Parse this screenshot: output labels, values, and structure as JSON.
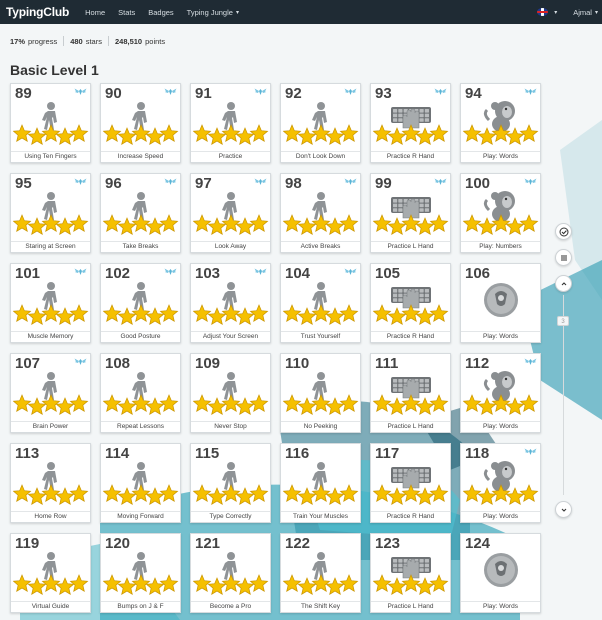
{
  "app": {
    "brand": "TypingClub"
  },
  "nav": [
    {
      "label": "Home",
      "dropdown": false
    },
    {
      "label": "Stats",
      "dropdown": false
    },
    {
      "label": "Badges",
      "dropdown": false
    },
    {
      "label": "Typing Jungle",
      "dropdown": true
    }
  ],
  "user": {
    "name": "Ajmal",
    "language_flag": "uk-flag-icon"
  },
  "stats": {
    "progress_value": "17%",
    "progress_label": "progress",
    "stars_value": "480",
    "stars_label": "stars",
    "points_value": "248,510",
    "points_label": "points"
  },
  "level": {
    "title": "Basic Level 1"
  },
  "side": {
    "page_indicator": "3"
  },
  "lessons": [
    {
      "num": "89",
      "label": "Using Ten Fingers",
      "type": "walk",
      "stars": 5,
      "badge": true
    },
    {
      "num": "90",
      "label": "Increase Speed",
      "type": "walk",
      "stars": 5,
      "badge": true
    },
    {
      "num": "91",
      "label": "Practice",
      "type": "walk",
      "stars": 5,
      "badge": true
    },
    {
      "num": "92",
      "label": "Don't Look Down",
      "type": "walk",
      "stars": 5,
      "badge": true
    },
    {
      "num": "93",
      "label": "Practice R Hand",
      "type": "hand",
      "stars": 5,
      "badge": true
    },
    {
      "num": "94",
      "label": "Play: Words",
      "type": "monkey",
      "stars": 5,
      "badge": true
    },
    {
      "num": "95",
      "label": "Staring at Screen",
      "type": "walk",
      "stars": 5,
      "badge": true
    },
    {
      "num": "96",
      "label": "Take Breaks",
      "type": "walk",
      "stars": 5,
      "badge": true
    },
    {
      "num": "97",
      "label": "Look Away",
      "type": "walk",
      "stars": 5,
      "badge": true
    },
    {
      "num": "98",
      "label": "Active Breaks",
      "type": "walk",
      "stars": 5,
      "badge": true
    },
    {
      "num": "99",
      "label": "Practice L Hand",
      "type": "hand",
      "stars": 5,
      "badge": true
    },
    {
      "num": "100",
      "label": "Play: Numbers",
      "type": "monkey",
      "stars": 5,
      "badge": true
    },
    {
      "num": "101",
      "label": "Muscle Memory",
      "type": "walk",
      "stars": 5,
      "badge": true
    },
    {
      "num": "102",
      "label": "Good Posture",
      "type": "walk",
      "stars": 5,
      "badge": true
    },
    {
      "num": "103",
      "label": "Adjust Your Screen",
      "type": "walk",
      "stars": 5,
      "badge": true
    },
    {
      "num": "104",
      "label": "Trust Yourself",
      "type": "walk",
      "stars": 5,
      "badge": true
    },
    {
      "num": "105",
      "label": "Practice R Hand",
      "type": "hand",
      "stars": 5,
      "badge": false
    },
    {
      "num": "106",
      "label": "Play: Words",
      "type": "game",
      "stars": 0,
      "badge": false
    },
    {
      "num": "107",
      "label": "Brain Power",
      "type": "walk",
      "stars": 5,
      "badge": true
    },
    {
      "num": "108",
      "label": "Repeat Lessons",
      "type": "walk",
      "stars": 5,
      "badge": false
    },
    {
      "num": "109",
      "label": "Never Stop",
      "type": "walk",
      "stars": 5,
      "badge": false
    },
    {
      "num": "110",
      "label": "No Peeking",
      "type": "walk",
      "stars": 5,
      "badge": false
    },
    {
      "num": "111",
      "label": "Practice L Hand",
      "type": "hand",
      "stars": 5,
      "badge": false
    },
    {
      "num": "112",
      "label": "Play: Words",
      "type": "monkey",
      "stars": 5,
      "badge": true
    },
    {
      "num": "113",
      "label": "Home Row",
      "type": "walk",
      "stars": 5,
      "badge": false
    },
    {
      "num": "114",
      "label": "Moving Forward",
      "type": "walk",
      "stars": 5,
      "badge": false
    },
    {
      "num": "115",
      "label": "Type Correctly",
      "type": "walk",
      "stars": 5,
      "badge": false
    },
    {
      "num": "116",
      "label": "Train Your Muscles",
      "type": "walk",
      "stars": 5,
      "badge": false
    },
    {
      "num": "117",
      "label": "Practice R Hand",
      "type": "hand",
      "stars": 5,
      "badge": false
    },
    {
      "num": "118",
      "label": "Play: Words",
      "type": "monkey",
      "stars": 5,
      "badge": true
    },
    {
      "num": "119",
      "label": "Virtual Guide",
      "type": "walk",
      "stars": 5,
      "badge": false
    },
    {
      "num": "120",
      "label": "Bumps on J & F",
      "type": "walk",
      "stars": 5,
      "badge": false
    },
    {
      "num": "121",
      "label": "Become a Pro",
      "type": "walk",
      "stars": 5,
      "badge": false
    },
    {
      "num": "122",
      "label": "The Shift Key",
      "type": "walk",
      "stars": 5,
      "badge": false
    },
    {
      "num": "123",
      "label": "Practice L Hand",
      "type": "hand",
      "stars": 5,
      "badge": false
    },
    {
      "num": "124",
      "label": "Play: Words",
      "type": "game",
      "stars": 0,
      "badge": false
    }
  ],
  "colors": {
    "topbar": "#1f2b34",
    "star": "#f5c000",
    "badge": "#5ab4d6",
    "bg_accent": "#2fa3b8"
  }
}
